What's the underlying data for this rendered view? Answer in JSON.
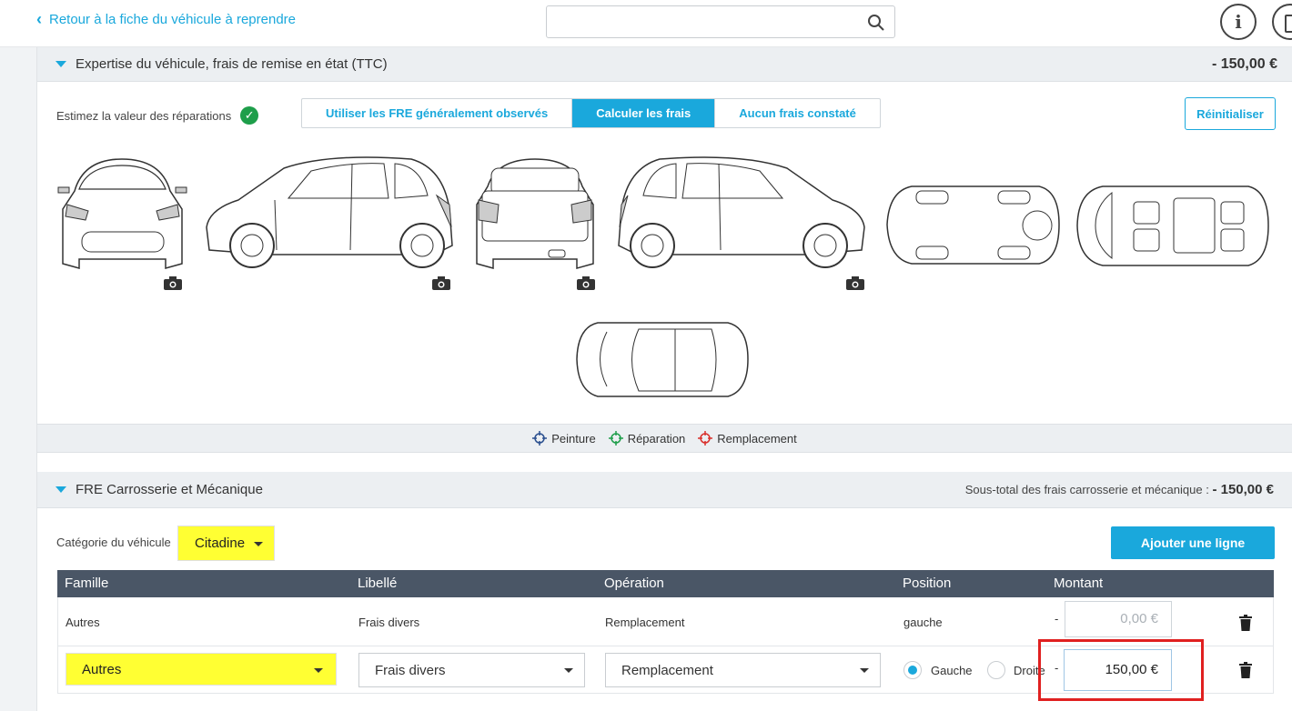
{
  "topbar": {
    "back_label": "Retour à la fiche du véhicule à reprendre",
    "search_placeholder": "",
    "info_label": "i"
  },
  "expertise": {
    "title": "Expertise du véhicule, frais de remise en état (TTC)",
    "total": "- 150,00 €",
    "estimate_label": "Estimez la valeur des réparations",
    "tabs": [
      "Utiliser les FRE généralement observés",
      "Calculer les frais",
      "Aucun frais constaté"
    ],
    "active_tab": "Calculer les frais",
    "reset_label": "Réinitialiser"
  },
  "legend": {
    "items": [
      {
        "label": "Peinture",
        "color": "#2a4f8f"
      },
      {
        "label": "Réparation",
        "color": "#1e9e4a"
      },
      {
        "label": "Remplacement",
        "color": "#d9302c"
      }
    ]
  },
  "fre": {
    "title": "FRE Carrosserie et Mécanique",
    "subtotal_label": "Sous-total des frais carrosserie et mécanique :",
    "subtotal_value": "- 150,00 €",
    "category_label": "Catégorie du véhicule",
    "category_value": "Citadine",
    "add_line_label": "Ajouter une ligne",
    "columns": [
      "Famille",
      "Libellé",
      "Opération",
      "Position",
      "Montant"
    ],
    "row1": {
      "famille": "Autres",
      "libelle": "Frais divers",
      "operation": "Remplacement",
      "position": "gauche",
      "minus": "-",
      "amount_placeholder": "0,00 €"
    },
    "row2": {
      "famille": "Autres",
      "libelle": "Frais divers",
      "operation": "Remplacement",
      "radio_left": "Gauche",
      "radio_right": "Droite",
      "minus": "-",
      "amount": "150,00",
      "currency": "€"
    }
  },
  "colors": {
    "accent": "#1aa8dc",
    "header_bg": "#4a5666",
    "highlight": "#ffff33",
    "annotation": "#e02020"
  }
}
